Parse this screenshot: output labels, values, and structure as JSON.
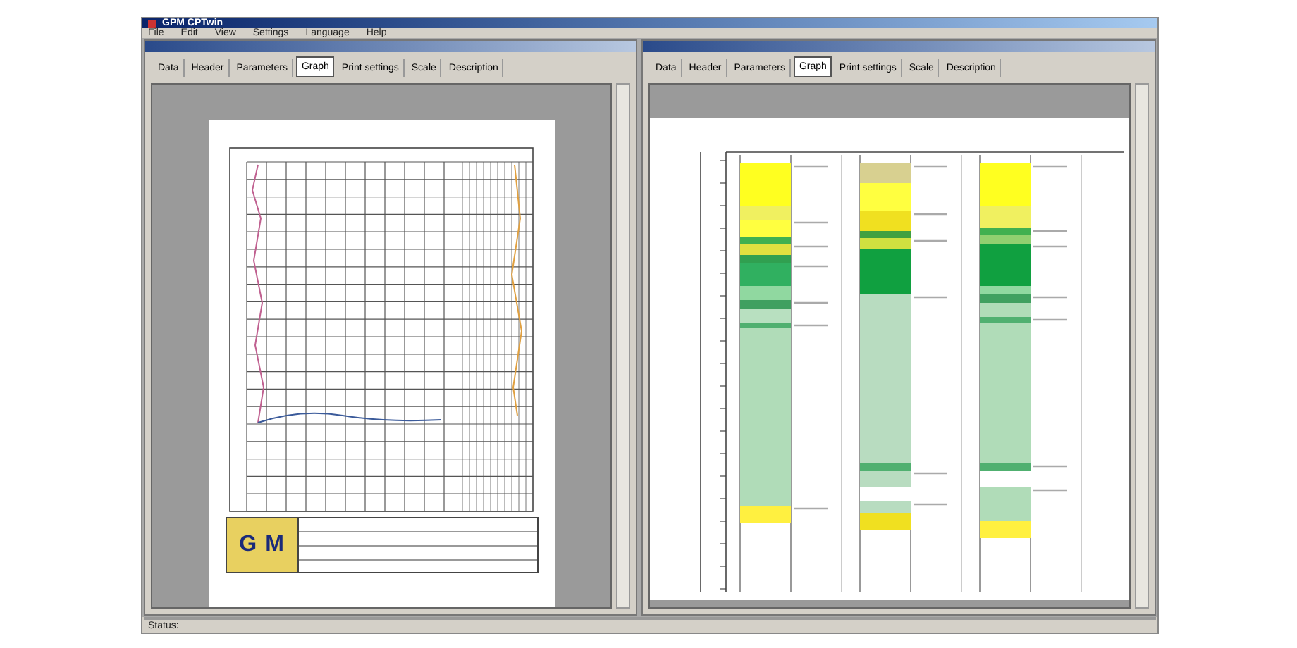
{
  "app": {
    "title": "GPM CPTwin"
  },
  "menu": [
    "File",
    "Edit",
    "View",
    "Settings",
    "Language",
    "Help"
  ],
  "windows": [
    {
      "kind": "grid",
      "tabs": [
        {
          "label": "Data",
          "selected": false
        },
        {
          "label": "Header",
          "selected": false
        },
        {
          "label": "Parameters",
          "selected": false
        },
        {
          "label": "Graph",
          "selected": true
        },
        {
          "label": "Print settings",
          "selected": false
        },
        {
          "label": "Scale",
          "selected": false
        },
        {
          "label": "Description",
          "selected": false
        }
      ],
      "logo": [
        "G",
        "M"
      ]
    },
    {
      "kind": "strata",
      "tabs": [
        {
          "label": "Data",
          "selected": false
        },
        {
          "label": "Header",
          "selected": false
        },
        {
          "label": "Parameters",
          "selected": false
        },
        {
          "label": "Graph",
          "selected": true
        },
        {
          "label": "Print settings",
          "selected": false
        },
        {
          "label": "Scale",
          "selected": false
        },
        {
          "label": "Description",
          "selected": false
        }
      ]
    }
  ],
  "status_bar": {
    "label": "Status:"
  }
}
